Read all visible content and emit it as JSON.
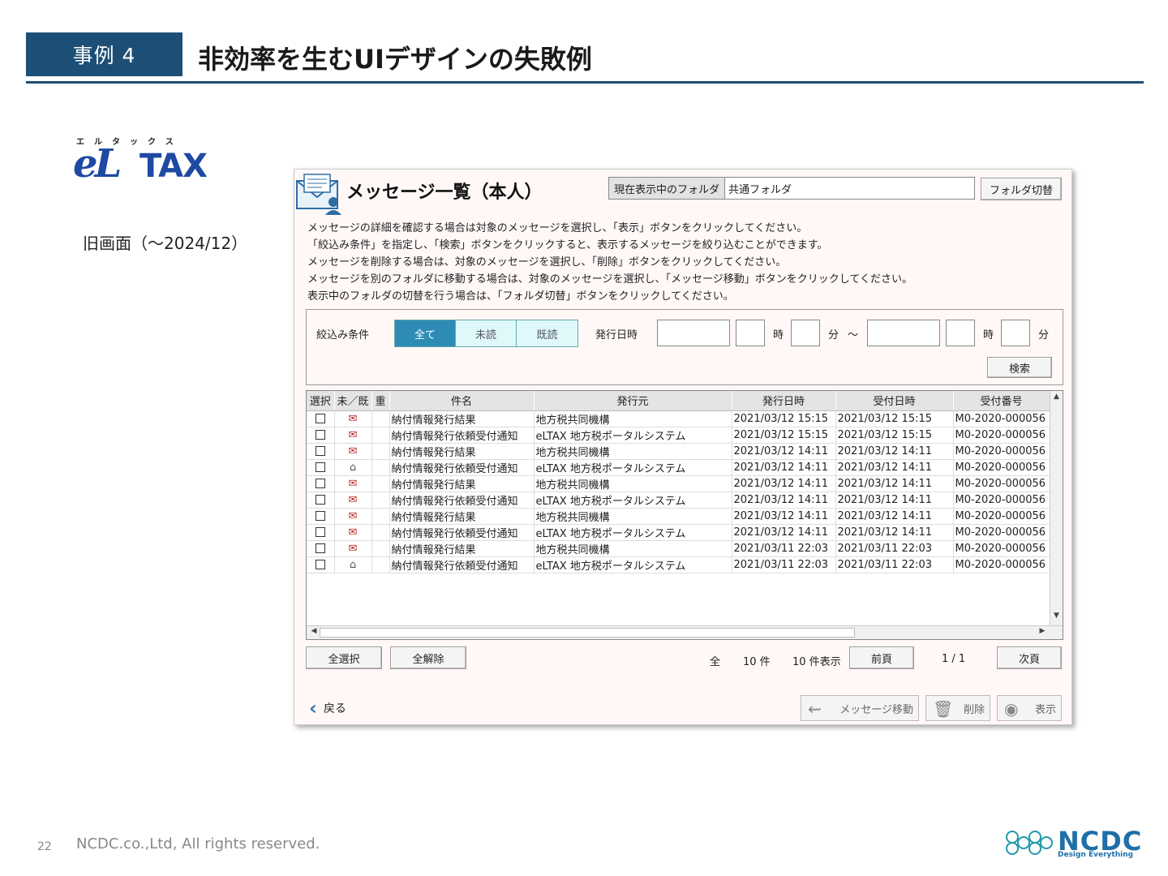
{
  "slide": {
    "badge": "事例 4",
    "title": "非効率を生むUIデザインの失敗例",
    "logo_kana": "エルタックス",
    "logo_mark": "eL",
    "logo_tax": "TAX",
    "old_label": "旧画面（〜2024/12）",
    "page_number": "22",
    "copyright": "NCDC.co.,Ltd, All rights reserved.",
    "brand": "NCDC",
    "brand_tagline": "Design Everything",
    "brand_color": "#1f6fa8",
    "accent_color": "#1d4f76"
  },
  "window": {
    "title": "メッセージ一覧（本人）",
    "folder_label": "現在表示中のフォルダ",
    "folder_value": "共通フォルダ",
    "folder_switch": "フォルダ切替",
    "instructions": [
      "メッセージの詳細を確認する場合は対象のメッセージを選択し、「表示」ボタンをクリックしてください。",
      "「絞込み条件」を指定し、「検索」ボタンをクリックすると、表示するメッセージを絞り込むことができます。",
      "メッセージを削除する場合は、対象のメッセージを選択し、「削除」ボタンをクリックしてください。",
      "メッセージを別のフォルダに移動する場合は、対象のメッセージを選択し、「メッセージ移動」ボタンをクリックしてください。",
      "表示中のフォルダの切替を行う場合は、「フォルダ切替」ボタンをクリックしてください。"
    ],
    "filter": {
      "label": "絞込み条件",
      "segments": [
        "全て",
        "未読",
        "既読"
      ],
      "selected": "全て",
      "date_label": "発行日時",
      "hour": "時",
      "minute": "分",
      "tilde": "〜",
      "search": "検索"
    },
    "table": {
      "headers": [
        "選択",
        "未／既",
        "重",
        "件名",
        "発行元",
        "発行日時",
        "受付日時",
        "受付番号"
      ],
      "rows": [
        {
          "status": "new",
          "subject": "納付情報発行結果",
          "issuer": "地方税共同機構",
          "issued": "2021/03/12 15:15",
          "received": "2021/03/12 15:15",
          "number": "M0-2020-000056"
        },
        {
          "status": "new",
          "subject": "納付情報発行依頼受付通知",
          "issuer": "eLTAX 地方税ポータルシステム",
          "issued": "2021/03/12 15:15",
          "received": "2021/03/12 15:15",
          "number": "M0-2020-000056"
        },
        {
          "status": "new",
          "subject": "納付情報発行結果",
          "issuer": "地方税共同機構",
          "issued": "2021/03/12 14:11",
          "received": "2021/03/12 14:11",
          "number": "M0-2020-000056"
        },
        {
          "status": "read",
          "subject": "納付情報発行依頼受付通知",
          "issuer": "eLTAX 地方税ポータルシステム",
          "issued": "2021/03/12 14:11",
          "received": "2021/03/12 14:11",
          "number": "M0-2020-000056"
        },
        {
          "status": "new",
          "subject": "納付情報発行結果",
          "issuer": "地方税共同機構",
          "issued": "2021/03/12 14:11",
          "received": "2021/03/12 14:11",
          "number": "M0-2020-000056"
        },
        {
          "status": "new",
          "subject": "納付情報発行依頼受付通知",
          "issuer": "eLTAX 地方税ポータルシステム",
          "issued": "2021/03/12 14:11",
          "received": "2021/03/12 14:11",
          "number": "M0-2020-000056"
        },
        {
          "status": "new",
          "subject": "納付情報発行結果",
          "issuer": "地方税共同機構",
          "issued": "2021/03/12 14:11",
          "received": "2021/03/12 14:11",
          "number": "M0-2020-000056"
        },
        {
          "status": "new",
          "subject": "納付情報発行依頼受付通知",
          "issuer": "eLTAX 地方税ポータルシステム",
          "issued": "2021/03/12 14:11",
          "received": "2021/03/12 14:11",
          "number": "M0-2020-000056"
        },
        {
          "status": "new",
          "subject": "納付情報発行結果",
          "issuer": "地方税共同機構",
          "issued": "2021/03/11 22:03",
          "received": "2021/03/11 22:03",
          "number": "M0-2020-000056"
        },
        {
          "status": "read",
          "subject": "納付情報発行依頼受付通知",
          "issuer": "eLTAX 地方税ポータルシステム",
          "issued": "2021/03/11 22:03",
          "received": "2021/03/11 22:03",
          "number": "M0-2020-000056"
        }
      ]
    },
    "select_all": "全選択",
    "deselect_all": "全解除",
    "total_label": "全",
    "total_count": "10 件",
    "display_count": "10 件表示",
    "prev": "前頁",
    "page": "1 / 1",
    "next": "次頁",
    "back": "戻る",
    "move": "メッセージ移動",
    "delete": "削除",
    "show": "表示"
  }
}
